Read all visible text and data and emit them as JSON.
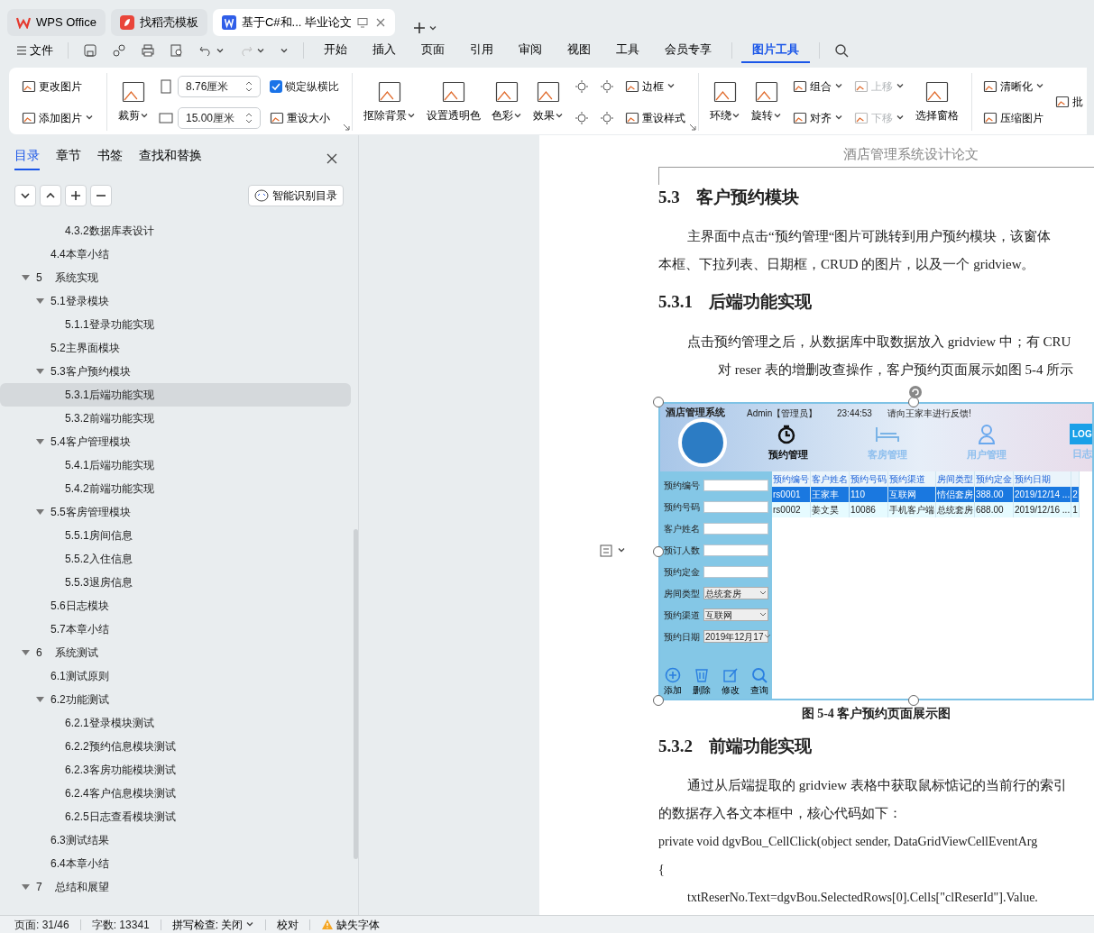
{
  "app_tabs": [
    {
      "label": "WPS Office",
      "kind": "home",
      "selected": false
    },
    {
      "label": "找稻壳模板",
      "kind": "templates",
      "selected": false
    },
    {
      "label": "基于C#和... 毕业论文",
      "kind": "document",
      "selected": true
    }
  ],
  "menu": {
    "file": "文件",
    "tabs": [
      {
        "label": "开始",
        "selected": false
      },
      {
        "label": "插入",
        "selected": false
      },
      {
        "label": "页面",
        "selected": false
      },
      {
        "label": "引用",
        "selected": false
      },
      {
        "label": "审阅",
        "selected": false
      },
      {
        "label": "视图",
        "selected": false
      },
      {
        "label": "工具",
        "selected": false
      },
      {
        "label": "会员专享",
        "selected": false
      },
      {
        "label": "图片工具",
        "selected": true
      }
    ]
  },
  "ribbon": {
    "groups": [
      {
        "columns": [
          [
            {
              "kind": "small",
              "label": "更改图片"
            },
            {
              "kind": "small",
              "label": "添加图片",
              "dropdown": true
            }
          ]
        ]
      },
      {
        "launcher": true,
        "columns": [
          [
            {
              "kind": "large",
              "label": "裁剪",
              "dropdown": true
            }
          ],
          [
            {
              "kind": "spin",
              "value": "8.76厘米"
            },
            {
              "kind": "spin",
              "value": "15.00厘米"
            }
          ],
          [
            {
              "kind": "check",
              "label": "锁定纵横比",
              "checked": true
            },
            {
              "kind": "small",
              "label": "重设大小"
            }
          ]
        ]
      },
      {
        "launcher": true,
        "columns": [
          [
            {
              "kind": "large",
              "label": "抠除背景",
              "dropdown": true
            }
          ],
          [
            {
              "kind": "large",
              "label": "设置透明色"
            }
          ],
          [
            {
              "kind": "large",
              "label": "色彩",
              "dropdown": true
            }
          ],
          [
            {
              "kind": "large",
              "label": "效果",
              "dropdown": true
            }
          ],
          [
            {
              "kind": "icon"
            },
            {
              "kind": "icon"
            }
          ],
          [
            {
              "kind": "icon"
            },
            {
              "kind": "icon"
            }
          ],
          [
            {
              "kind": "small",
              "label": "边框",
              "dropdown": true
            },
            {
              "kind": "small",
              "label": "重设样式"
            }
          ]
        ]
      },
      {
        "columns": [
          [
            {
              "kind": "large",
              "label": "环绕",
              "dropdown": true
            }
          ],
          [
            {
              "kind": "large",
              "label": "旋转",
              "dropdown": true
            }
          ],
          [
            {
              "kind": "small",
              "label": "组合",
              "dropdown": true
            },
            {
              "kind": "small",
              "label": "对齐",
              "dropdown": true
            }
          ],
          [
            {
              "kind": "small",
              "label": "上移",
              "dropdown": true,
              "disabled": true
            },
            {
              "kind": "small",
              "label": "下移",
              "dropdown": true,
              "disabled": true
            }
          ],
          [
            {
              "kind": "large",
              "label": "选择窗格"
            }
          ]
        ]
      },
      {
        "columns": [
          [
            {
              "kind": "small",
              "label": "清晰化",
              "dropdown": true
            },
            {
              "kind": "small",
              "label": "压缩图片"
            }
          ],
          [
            {
              "kind": "small",
              "label": "批"
            }
          ]
        ]
      }
    ]
  },
  "nav_panel": {
    "tabs": [
      {
        "label": "目录",
        "selected": true
      },
      {
        "label": "章节",
        "selected": false
      },
      {
        "label": "书签",
        "selected": false
      },
      {
        "label": "查找和替换",
        "selected": false
      }
    ],
    "smart_toc_button": "智能识别目录",
    "toc": [
      {
        "children": [
          {
            "children": [
              {
                "label": "4.3.2数据库表设计",
                "selected": false
              }
            ]
          },
          {
            "label": "4.4本章小结",
            "selected": false
          }
        ]
      },
      {
        "number": "5",
        "label": "系统实现",
        "selected": false,
        "expanded": true,
        "children": [
          {
            "label": "5.1登录模块",
            "selected": false,
            "expanded": true,
            "children": [
              {
                "label": "5.1.1登录功能实现",
                "selected": false
              }
            ]
          },
          {
            "label": "5.2主界面模块",
            "selected": false
          },
          {
            "label": "5.3客户预约模块",
            "selected": false,
            "expanded": true,
            "children": [
              {
                "label": "5.3.1后端功能实现",
                "selected": true
              },
              {
                "label": "5.3.2前端功能实现",
                "selected": false
              }
            ]
          },
          {
            "label": "5.4客户管理模块",
            "selected": false,
            "expanded": true,
            "children": [
              {
                "label": "5.4.1后端功能实现",
                "selected": false
              },
              {
                "label": "5.4.2前端功能实现",
                "selected": false
              }
            ]
          },
          {
            "label": "5.5客房管理模块",
            "selected": false,
            "expanded": true,
            "children": [
              {
                "label": "5.5.1房间信息",
                "selected": false
              },
              {
                "label": "5.5.2入住信息",
                "selected": false
              },
              {
                "label": "5.5.3退房信息",
                "selected": false
              }
            ]
          },
          {
            "label": "5.6日志模块",
            "selected": false
          },
          {
            "label": "5.7本章小结",
            "selected": false
          }
        ]
      },
      {
        "number": "6",
        "label": "系统测试",
        "selected": false,
        "expanded": true,
        "children": [
          {
            "label": "6.1测试原则",
            "selected": false
          },
          {
            "label": "6.2功能测试",
            "selected": false,
            "expanded": true,
            "children": [
              {
                "label": "6.2.1登录模块测试",
                "selected": false
              },
              {
                "label": "6.2.2预约信息模块测试",
                "selected": false
              },
              {
                "label": "6.2.3客房功能模块测试",
                "selected": false
              },
              {
                "label": "6.2.4客户信息模块测试",
                "selected": false
              },
              {
                "label": "6.2.5日志查看模块测试",
                "selected": false
              }
            ]
          },
          {
            "label": "6.3测试结果",
            "selected": false
          },
          {
            "label": "6.4本章小结",
            "selected": false
          }
        ]
      },
      {
        "number": "7",
        "label": "总结和展望",
        "selected": false,
        "expanded": true
      }
    ]
  },
  "document": {
    "header": "酒店管理系统设计论文",
    "blocks": [
      {
        "kind": "heading",
        "number": "5.3",
        "title": "客户预约模块"
      },
      {
        "kind": "para",
        "lines": [
          "主界面中点击“预约管理“图片可跳转到用户预约模块，该窗体",
          "本框、下拉列表、日期框，CRUD 的图片，以及一个 gridview。"
        ]
      },
      {
        "kind": "heading",
        "number": "5.3.1",
        "title": "后端功能实现"
      },
      {
        "kind": "para",
        "lines": [
          "点击预约管理之后，从数据库中取数据放入 gridview 中；有 CRU",
          "对 reser 表的增删改查操作，客户预约页面展示如图 5-4 所示"
        ]
      },
      {
        "kind": "figure",
        "caption": "图 5-4  客户预约页面展示图",
        "screenshot": {
          "title": "酒店管理系统",
          "user": "Admin【管理员】",
          "time": "23:44:53",
          "notice": "请向王家丰进行反馈!",
          "nav": [
            {
              "label": "预约管理",
              "selected": true
            },
            {
              "label": "客房管理",
              "selected": false
            },
            {
              "label": "用户管理",
              "selected": false
            },
            {
              "label": "日志",
              "badge": "LOG",
              "selected": false
            }
          ],
          "fields": [
            {
              "kind": "text",
              "label": "预约编号"
            },
            {
              "kind": "text",
              "label": "预约号码"
            },
            {
              "kind": "text",
              "label": "客户姓名"
            },
            {
              "kind": "text",
              "label": "预订人数"
            },
            {
              "kind": "text",
              "label": "预约定金"
            },
            {
              "kind": "select",
              "label": "房间类型",
              "value": "总统套房"
            },
            {
              "kind": "select",
              "label": "预约渠道",
              "value": "互联网"
            },
            {
              "kind": "select",
              "label": "预约日期",
              "value": "2019年12月17"
            }
          ],
          "actions": [
            "添加",
            "删除",
            "修改",
            "查询"
          ],
          "columns": [
            "预约编号",
            "客户姓名",
            "预约号码",
            "预约渠道",
            "房间类型",
            "预约定金",
            "预约日期"
          ],
          "rows": [
            {
              "selected": true,
              "cells": [
                "rs0001",
                "王家丰",
                "110",
                "互联网",
                "情侣套房",
                "388.00",
                "2019/12/14 ...",
                "2"
              ]
            },
            {
              "selected": false,
              "cells": [
                "rs0002",
                "姜文昊",
                "10086",
                "手机客户端",
                "总统套房",
                "688.00",
                "2019/12/16 ...",
                "1"
              ]
            }
          ]
        }
      },
      {
        "kind": "heading",
        "number": "5.3.2",
        "title": "前端功能实现"
      },
      {
        "kind": "para",
        "lines": [
          "通过从后端提取的 gridview 表格中获取鼠标惦记的当前行的索引",
          "的数据存入各文本框中，核心代码如下："
        ]
      },
      {
        "kind": "code",
        "lines": [
          "private void dgvBou_CellClick(object sender, DataGridViewCellEventArg",
          "{",
          "txtReserNo.Text=dgvBou.SelectedRows[0].Cells[\"clReserId\"].Value."
        ]
      }
    ]
  },
  "status_bar": {
    "page": "页面: 31/46",
    "words": "字数: 13341",
    "spell_check": "拼写检查: 关闭",
    "proofread": "校对",
    "missing_fonts": "缺失字体"
  }
}
